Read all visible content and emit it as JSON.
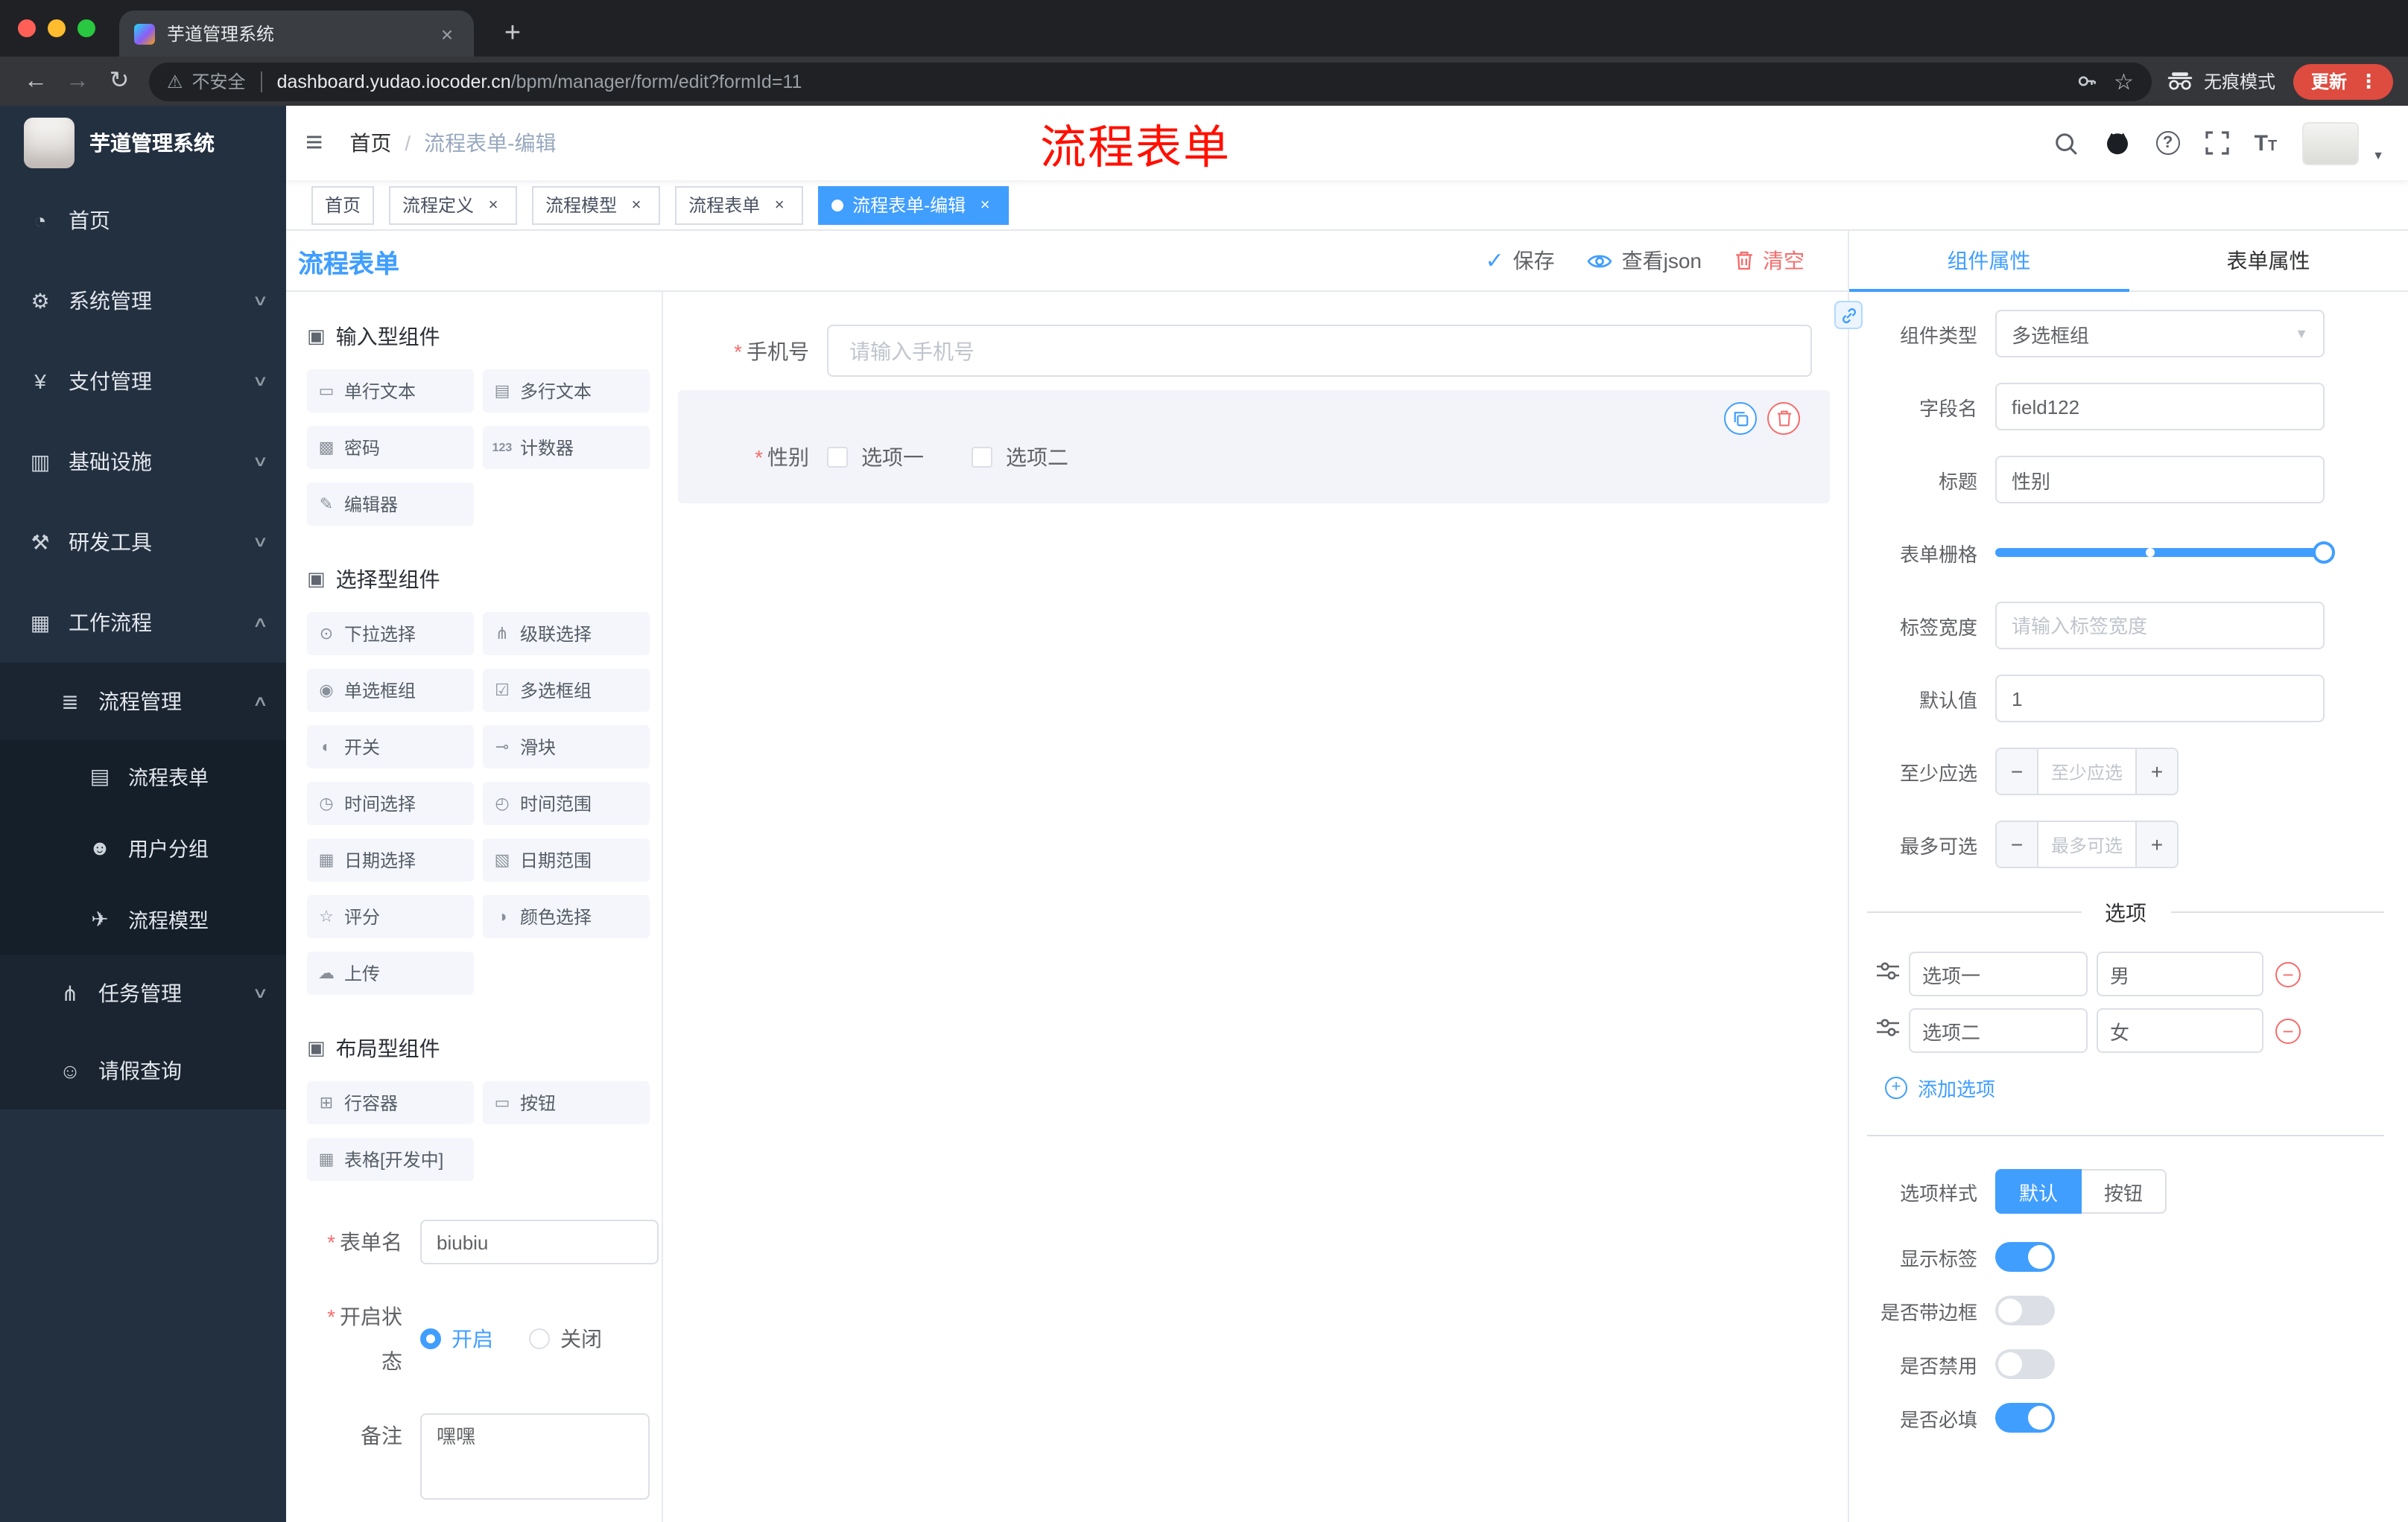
{
  "browser": {
    "tab_title": "芋道管理系统",
    "security_label": "不安全",
    "url_host": "dashboard.yudao.iocoder.cn",
    "url_path": "/bpm/manager/form/edit?formId=11",
    "incognito_label": "无痕模式",
    "update_label": "更新"
  },
  "annotation": {
    "label": "流程表单"
  },
  "sidebar": {
    "app_title": "芋道管理系统",
    "items": [
      {
        "glyph": "◔",
        "label": "首页",
        "arrow": ""
      },
      {
        "glyph": "⚙",
        "label": "系统管理",
        "arrow": "∨"
      },
      {
        "glyph": "¥",
        "label": "支付管理",
        "arrow": "∨"
      },
      {
        "glyph": "▥",
        "label": "基础设施",
        "arrow": "∨"
      },
      {
        "glyph": "⚒",
        "label": "研发工具",
        "arrow": "∨"
      },
      {
        "glyph": "▦",
        "label": "工作流程",
        "arrow": "∧"
      }
    ],
    "group": {
      "glyph": "≣",
      "label": "流程管理",
      "arrow": "∧"
    },
    "children": [
      {
        "glyph": "▤",
        "label": "流程表单"
      },
      {
        "glyph": "☻",
        "label": "用户分组"
      },
      {
        "glyph": "✈",
        "label": "流程模型"
      }
    ],
    "task": {
      "glyph": "⋔",
      "label": "任务管理",
      "arrow": "∨"
    },
    "leave": {
      "glyph": "☺",
      "label": "请假查询"
    }
  },
  "header": {
    "home": "首页",
    "sep": "/",
    "current": "流程表单-编辑"
  },
  "tags": [
    {
      "label": "首页"
    },
    {
      "label": "流程定义"
    },
    {
      "label": "流程模型"
    },
    {
      "label": "流程表单"
    },
    {
      "label": "流程表单-编辑"
    }
  ],
  "designer": {
    "title": "流程表单",
    "save_label": "保存",
    "json_label": "查看json",
    "clear_label": "清空",
    "groups": [
      {
        "title": "输入型组件",
        "items": [
          {
            "glyph": "▭",
            "label": "单行文本"
          },
          {
            "glyph": "▤",
            "label": "多行文本"
          },
          {
            "glyph": "▩",
            "label": "密码"
          },
          {
            "glyph": "123",
            "label": "计数器"
          },
          {
            "glyph": "✎",
            "label": "编辑器"
          }
        ]
      },
      {
        "title": "选择型组件",
        "items": [
          {
            "glyph": "⊙",
            "label": "下拉选择"
          },
          {
            "glyph": "⋔",
            "label": "级联选择"
          },
          {
            "glyph": "◉",
            "label": "单选框组"
          },
          {
            "glyph": "☑",
            "label": "多选框组"
          },
          {
            "glyph": "◐",
            "label": "开关"
          },
          {
            "glyph": "⊸",
            "label": "滑块"
          },
          {
            "glyph": "◷",
            "label": "时间选择"
          },
          {
            "glyph": "◴",
            "label": "时间范围"
          },
          {
            "glyph": "▦",
            "label": "日期选择"
          },
          {
            "glyph": "▧",
            "label": "日期范围"
          },
          {
            "glyph": "☆",
            "label": "评分"
          },
          {
            "glyph": "◑",
            "label": "颜色选择"
          },
          {
            "glyph": "☁",
            "label": "上传"
          }
        ]
      },
      {
        "title": "布局型组件",
        "items": [
          {
            "glyph": "⊞",
            "label": "行容器"
          },
          {
            "glyph": "▭",
            "label": "按钮"
          },
          {
            "glyph": "▦",
            "label": "表格[开发中]"
          }
        ]
      }
    ],
    "meta": {
      "name_label": "表单名",
      "name_value": "biubiu",
      "status_label": "开启状态",
      "status_on": "开启",
      "status_off": "关闭",
      "remark_label": "备注",
      "remark_value": "嘿嘿"
    },
    "canvas": {
      "phone_label": "手机号",
      "phone_placeholder": "请输入手机号",
      "gender_label": "性别",
      "gender_opt1": "选项一",
      "gender_opt2": "选项二"
    }
  },
  "props": {
    "tab_component": "组件属性",
    "tab_form": "表单属性",
    "type_label": "组件类型",
    "type_value": "多选框组",
    "field_label": "字段名",
    "field_value": "field122",
    "title_label": "标题",
    "title_value": "性别",
    "grid_label": "表单栅格",
    "width_label": "标签宽度",
    "width_placeholder": "请输入标签宽度",
    "default_label": "默认值",
    "default_value": "1",
    "min_label": "至少应选",
    "min_placeholder": "至少应选",
    "max_label": "最多可选",
    "max_placeholder": "最多可选",
    "options_title": "选项",
    "options": [
      {
        "name": "选项一",
        "value": "男"
      },
      {
        "name": "选项二",
        "value": "女"
      }
    ],
    "add_label": "添加选项",
    "style_label": "选项样式",
    "style_default": "默认",
    "style_button": "按钮",
    "show_label": "显示标签",
    "border_label": "是否带边框",
    "disabled_label": "是否禁用",
    "required_label": "是否必填"
  },
  "colors": {
    "primary": "#409eff",
    "danger": "#f56c6c",
    "sidebar_bg": "#233040",
    "tag_active": "#409eff",
    "annotation_red": "#ff1000"
  }
}
